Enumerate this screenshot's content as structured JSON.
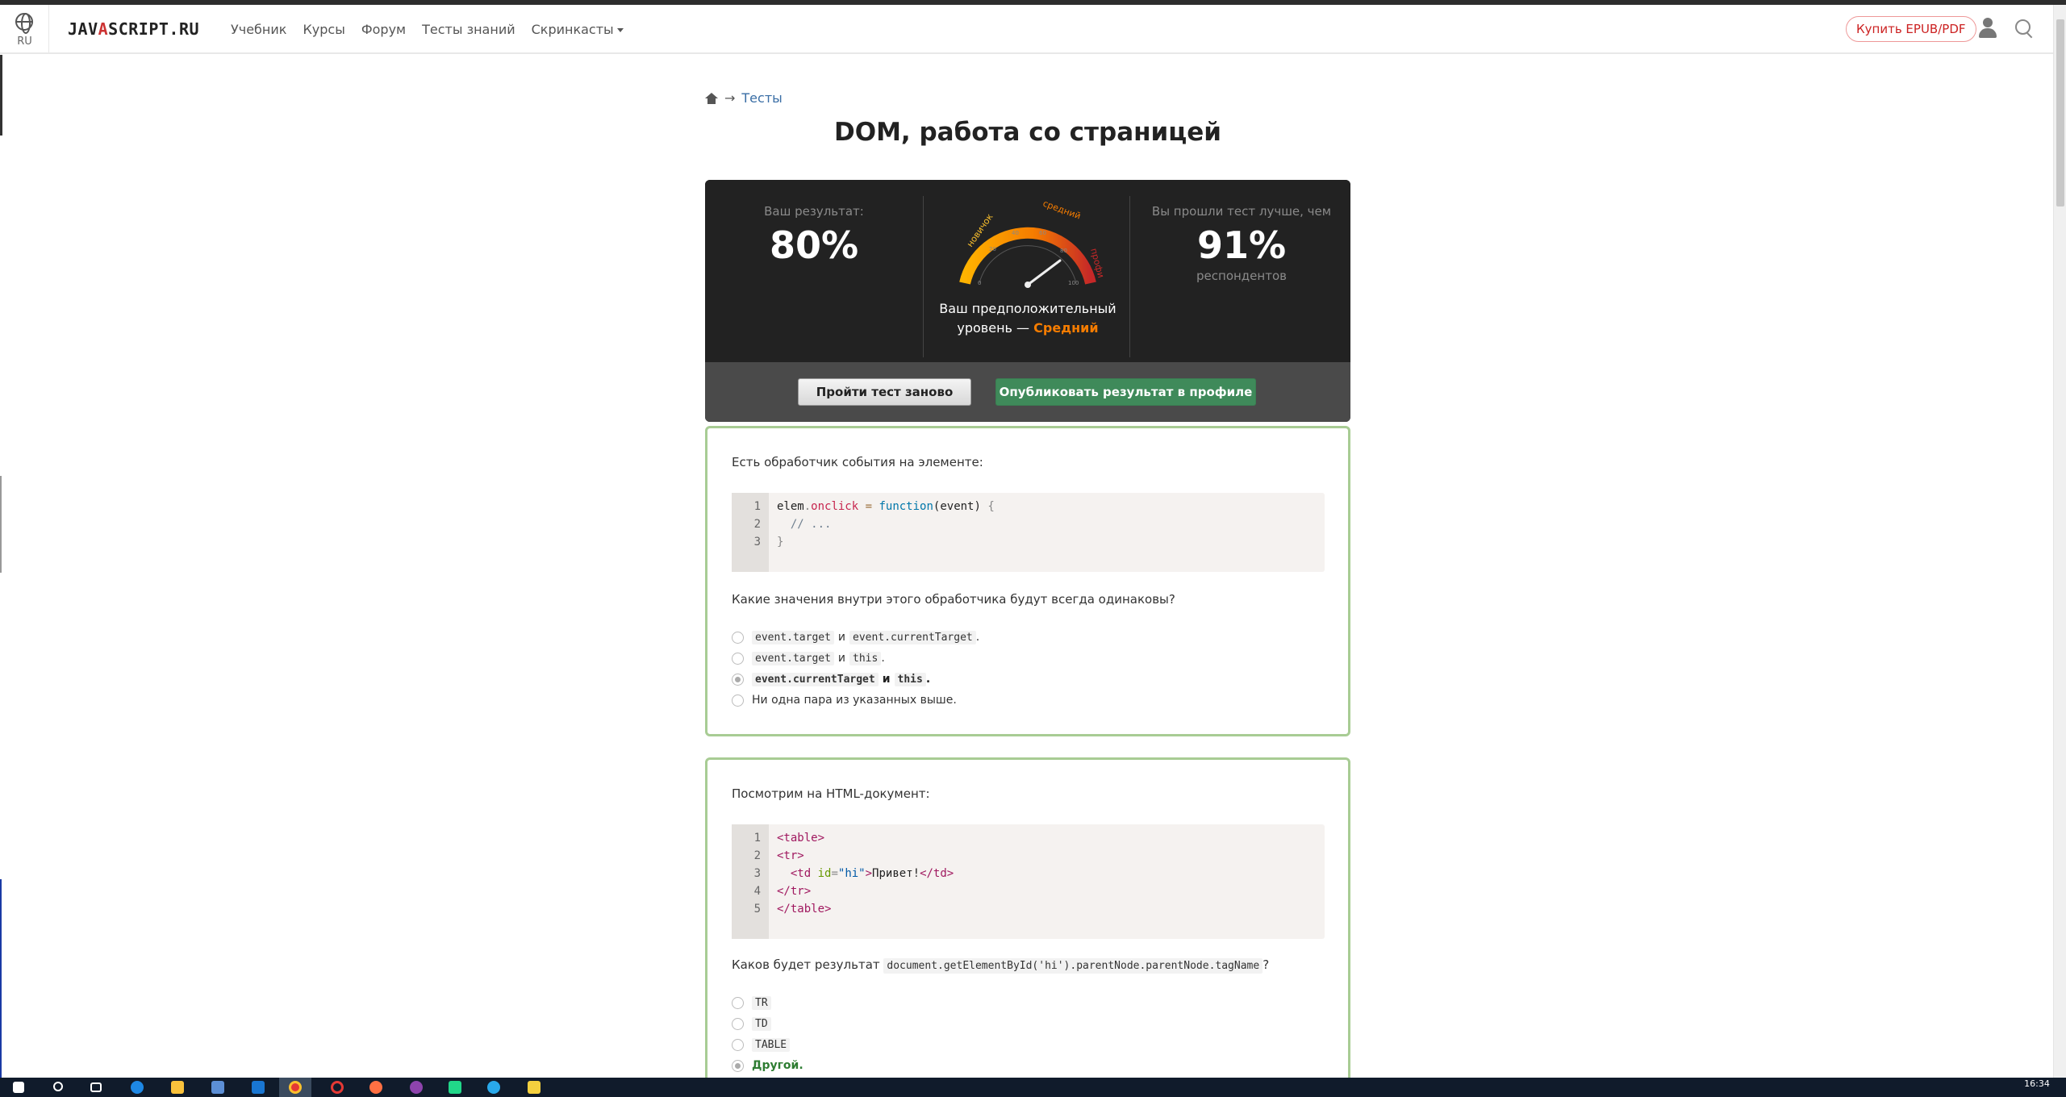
{
  "navbar": {
    "lang_code": "RU",
    "logo_pre": "JAV",
    "logo_a": "A",
    "logo_post": "SCRIPT.RU",
    "links": [
      "Учебник",
      "Курсы",
      "Форум",
      "Тесты знаний",
      "Скринкасты"
    ],
    "buy_label": "Купить EPUB/PDF"
  },
  "breadcrumb": {
    "arrow": "→",
    "link": "Тесты"
  },
  "page_title": "DOM, работа со страницей",
  "result": {
    "your_result_label": "Ваш результат:",
    "your_result_value": "80%",
    "better_than_label": "Вы прошли тест лучше, чем",
    "better_than_value": "91%",
    "better_than_sub": "респондентов",
    "level_prefix": "Ваш предположительный",
    "level_line2": "уровень — ",
    "level_value": "Средний",
    "gauge": {
      "labels": [
        "новичок",
        "средний",
        "профи"
      ],
      "ticks": [
        "0",
        "20",
        "40",
        "60",
        "80",
        "100"
      ],
      "value": 80
    },
    "retry_label": "Пройти тест заново",
    "publish_label": "Опубликовать результат в профиле"
  },
  "questions": [
    {
      "intro": "Есть обработчик события на элементе:",
      "code_lines": [
        "1",
        "2",
        "3"
      ],
      "code": {
        "l1_var": "elem",
        "l1_dot": ".",
        "l1_prop": "onclick",
        "l1_eq": " = ",
        "l1_kw": "function",
        "l1_args": "(event)",
        "l1_brace": " {",
        "l2": "  // ...",
        "l3": "}"
      },
      "question": "Какие значения внутри этого обработчика будут всегда одинаковы?",
      "answers": [
        {
          "a": "event.target",
          "sep": "и",
          "b": "event.currentTarget",
          "end": "."
        },
        {
          "a": "event.target",
          "sep": "и",
          "b": "this",
          "end": "."
        },
        {
          "a": "event.currentTarget",
          "sep": "и",
          "b": "this",
          "end": "."
        },
        {
          "text": "Ни одна пара из указанных выше."
        }
      ]
    },
    {
      "intro": "Посмотрим на HTML-документ:",
      "code_lines": [
        "1",
        "2",
        "3",
        "4",
        "5"
      ],
      "code": {
        "l1": "<table>",
        "l2": "<tr>",
        "l3_open": "  <td",
        "l3_attr": " id",
        "l3_eq": "=",
        "l3_str": "\"hi\"",
        "l3_close": ">",
        "l3_text": "Привет!",
        "l3_end": "</td>",
        "l4": "</tr>",
        "l5": "</table>"
      },
      "question_prefix": "Каков будет результат",
      "question_code": "document.getElementById('hi').parentNode.parentNode.tagName",
      "question_suffix": "?",
      "answers": [
        "TR",
        "TD",
        "TABLE",
        "Другой."
      ]
    }
  ],
  "taskbar": {
    "time": "16:34"
  },
  "colors": {
    "accent_green": "#3f8a5a",
    "level_orange": "#f57c00",
    "card_border": "#a8cc94",
    "link_blue": "#3a6ea5"
  }
}
